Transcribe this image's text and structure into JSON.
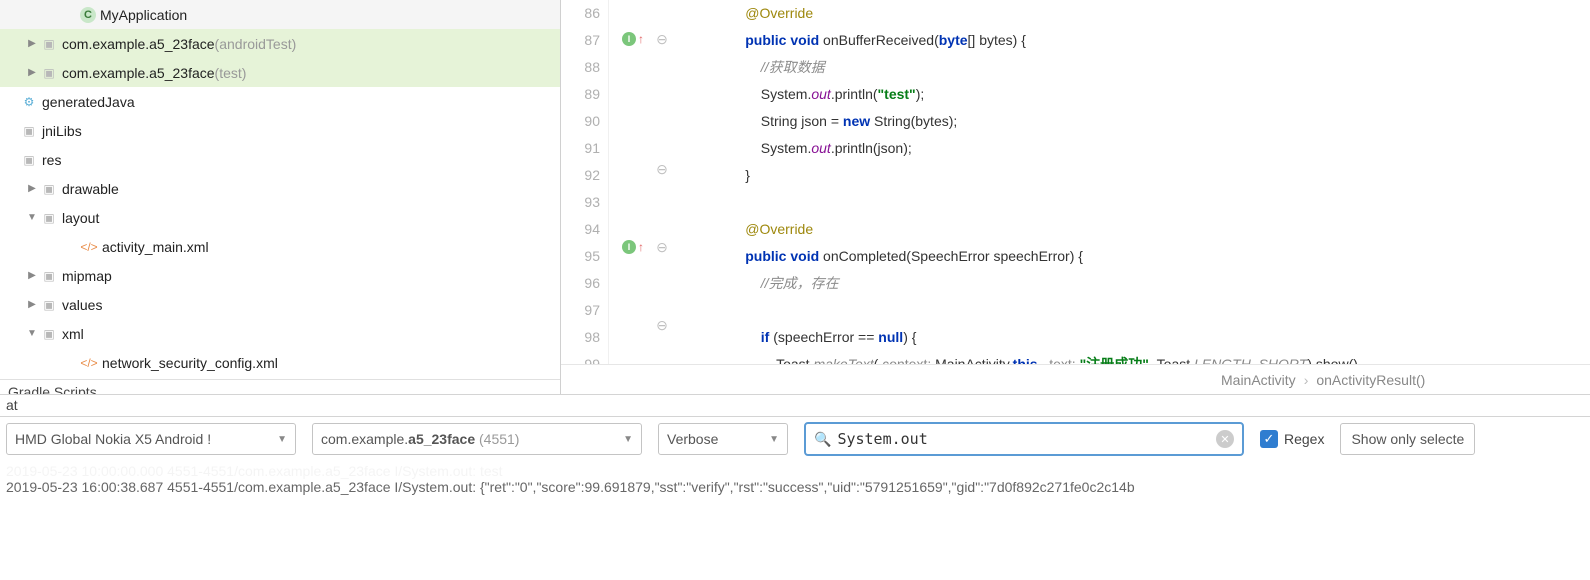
{
  "tree": {
    "items": [
      {
        "indent": 3,
        "tri": "",
        "icon": "cls",
        "label": "MyApplication",
        "muted": "",
        "hi": false,
        "type": "class"
      },
      {
        "indent": 1,
        "tri": "▶",
        "icon": "pkg",
        "label": "com.example.a5_23face ",
        "muted": "(androidTest)",
        "hi": true,
        "type": "package"
      },
      {
        "indent": 1,
        "tri": "▶",
        "icon": "pkg",
        "label": "com.example.a5_23face ",
        "muted": "(test)",
        "hi": true,
        "type": "package"
      },
      {
        "indent": 0,
        "tri": "",
        "icon": "gj",
        "label": "generatedJava",
        "muted": "",
        "hi": false,
        "type": "gen"
      },
      {
        "indent": 0,
        "tri": "",
        "icon": "folder",
        "label": "jniLibs",
        "muted": "",
        "hi": false,
        "type": "folder"
      },
      {
        "indent": 0,
        "tri": "",
        "icon": "folder",
        "label": "res",
        "muted": "",
        "hi": false,
        "type": "folder"
      },
      {
        "indent": 1,
        "tri": "▶",
        "icon": "folder",
        "label": "drawable",
        "muted": "",
        "hi": false,
        "type": "folder"
      },
      {
        "indent": 1,
        "tri": "▼",
        "icon": "folder",
        "label": "layout",
        "muted": "",
        "hi": false,
        "type": "folder"
      },
      {
        "indent": 3,
        "tri": "",
        "icon": "xml",
        "label": "activity_main.xml",
        "muted": "",
        "hi": false,
        "type": "xml"
      },
      {
        "indent": 1,
        "tri": "▶",
        "icon": "folder",
        "label": "mipmap",
        "muted": "",
        "hi": false,
        "type": "folder"
      },
      {
        "indent": 1,
        "tri": "▶",
        "icon": "folder",
        "label": "values",
        "muted": "",
        "hi": false,
        "type": "folder"
      },
      {
        "indent": 1,
        "tri": "▼",
        "icon": "folder",
        "label": "xml",
        "muted": "",
        "hi": false,
        "type": "folder"
      },
      {
        "indent": 3,
        "tri": "",
        "icon": "xml",
        "label": "network_security_config.xml",
        "muted": "",
        "hi": false,
        "type": "xml"
      }
    ],
    "footer": "Gradle Scripts"
  },
  "code": {
    "lines": [
      {
        "n": 86,
        "mark": "",
        "fold": "",
        "html": "<span class='ann'>@Override</span>"
      },
      {
        "n": 87,
        "mark": "I↑",
        "fold": "⊖",
        "html": "<span class='kw'>public</span> <span class='kw'>void</span> onBufferReceived(<span class='kw'>byte</span>[] bytes) {"
      },
      {
        "n": 88,
        "mark": "",
        "fold": "",
        "html": "    <span class='cmt'>//获取数据</span>"
      },
      {
        "n": 89,
        "mark": "",
        "fold": "",
        "html": "    System.<span class='field'>out</span>.println(<span class='str'>\"test\"</span>);"
      },
      {
        "n": 90,
        "mark": "",
        "fold": "",
        "html": "    String json = <span class='kw'>new</span> String(bytes);"
      },
      {
        "n": 91,
        "mark": "",
        "fold": "",
        "html": "    System.<span class='field'>out</span>.println(json);"
      },
      {
        "n": 92,
        "mark": "",
        "fold": "⊖",
        "html": "}"
      },
      {
        "n": 93,
        "mark": "",
        "fold": "",
        "html": ""
      },
      {
        "n": 94,
        "mark": "",
        "fold": "",
        "html": "<span class='ann'>@Override</span>"
      },
      {
        "n": 95,
        "mark": "I↑",
        "fold": "⊖",
        "html": "<span class='kw'>public</span> <span class='kw'>void</span> onCompleted(SpeechError speechError) {"
      },
      {
        "n": 96,
        "mark": "",
        "fold": "",
        "html": "    <span class='cmt'>//完成，存在</span>"
      },
      {
        "n": 97,
        "mark": "",
        "fold": "",
        "html": ""
      },
      {
        "n": 98,
        "mark": "",
        "fold": "⊖",
        "html": "    <span class='kw'>if</span> (speechError == <span class='kw'>null</span>) {"
      },
      {
        "n": 99,
        "mark": "",
        "fold": "",
        "html": "        Toast.<span class='paramItalic'>makeText</span>( <span class='param'>context:</span> MainActivity.<span class='kw'>this</span>,  <span class='param'>text:</span> <span class='str'>\"注册成功\"</span>, Toast.<span class='paramItalic'>LENGTH_SHORT</span>).show()"
      }
    ],
    "indentBase": "                "
  },
  "breadcrumb": {
    "a": "MainActivity",
    "sep": "›",
    "b": "onActivityResult()"
  },
  "logcat": {
    "tab": "at"
  },
  "toolbar": {
    "device": "HMD Global Nokia X5 Android !",
    "process_app": "com.example.",
    "process_bold": "a5_23face",
    "process_pid": " (4551)",
    "level": "Verbose",
    "search_value": "System.out",
    "regex_label": "Regex",
    "showonly": "Show only selecte"
  },
  "output": {
    "l1": "2019-05-23 10:00:00.000 4551-4551/com.example.a5_23face I/System.out: test",
    "l2": "2019-05-23 16:00:38.687 4551-4551/com.example.a5_23face I/System.out: {\"ret\":\"0\",\"score\":99.691879,\"sst\":\"verify\",\"rst\":\"success\",\"uid\":\"5791251659\",\"gid\":\"7d0f892c271fe0c2c14b"
  }
}
